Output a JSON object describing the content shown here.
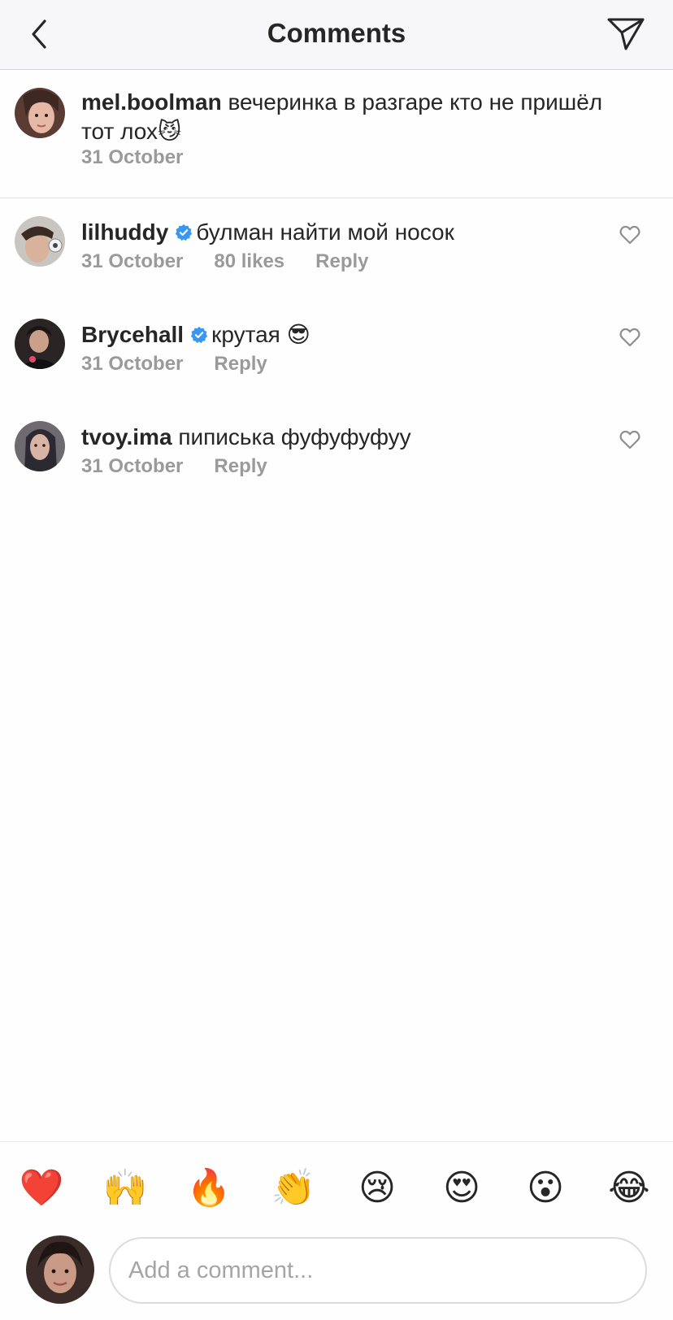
{
  "header": {
    "title": "Comments"
  },
  "caption": {
    "username": "mel.boolman",
    "text": "вечеринка в разгаре кто не пришёл тот лох😼",
    "date": "31 October"
  },
  "comments": [
    {
      "username": "lilhuddy",
      "verified": true,
      "text": "булман найти мой носок",
      "date": "31 October",
      "likes": "80 likes",
      "reply": "Reply"
    },
    {
      "username": "Brycehall",
      "verified": true,
      "text": "крутая 😎",
      "date": "31 October",
      "reply": "Reply"
    },
    {
      "username": "tvoy.ima",
      "verified": false,
      "text": "пиписька фуфуфуфуу",
      "date": "31 October",
      "reply": "Reply"
    }
  ],
  "emoji_bar": [
    "❤️",
    "🙌",
    "🔥",
    "👏",
    "😢",
    "😍",
    "😮",
    "😂"
  ],
  "composer": {
    "placeholder": "Add a comment..."
  },
  "icons": {
    "back": "chevron-left-icon",
    "send": "paper-plane-icon",
    "like": "heart-outline-icon",
    "verified": "verified-badge-icon"
  },
  "colors": {
    "verified": "#3897f0",
    "secondary_text": "#9a9a9a",
    "primary_text": "#262626"
  }
}
